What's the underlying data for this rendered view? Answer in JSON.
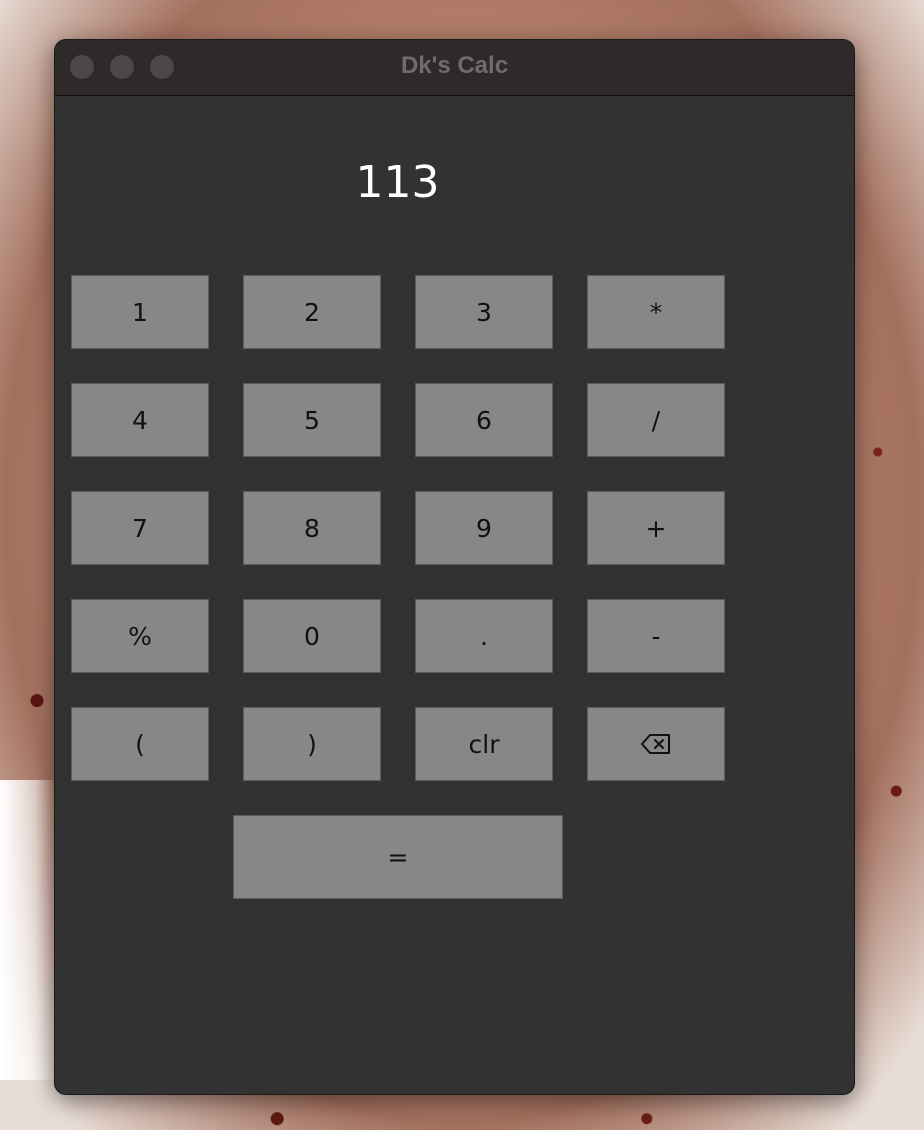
{
  "window": {
    "title": "Dk's Calc"
  },
  "display": {
    "value": "113"
  },
  "keypad": {
    "row1": [
      "1",
      "2",
      "3",
      "*"
    ],
    "row2": [
      "4",
      "5",
      "6",
      "/"
    ],
    "row3": [
      "7",
      "8",
      "9",
      "+"
    ],
    "row4": [
      "%",
      "0",
      ".",
      "-"
    ],
    "row5": [
      "(",
      ")",
      "clr"
    ],
    "backspace_icon": "backspace-icon",
    "equals": "="
  },
  "colors": {
    "window_bg": "#323232",
    "key_bg": "#878787",
    "display_text": "#ffffff"
  }
}
